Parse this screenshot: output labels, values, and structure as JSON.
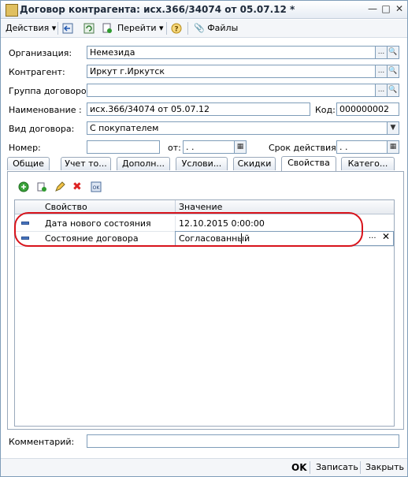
{
  "window": {
    "title": "Договор контрагента: исх.366/34074 от 05.07.12 *"
  },
  "toolbar": {
    "actions_label": "Действия",
    "goto_label": "Перейти",
    "files_label": "Файлы"
  },
  "form": {
    "organization_label": "Организация:",
    "organization_value": "Немезида",
    "contractor_label": "Контрагент:",
    "contractor_value": "Иркут г.Иркутск",
    "group_label": "Группа договоров:",
    "group_value": "",
    "name_label": "Наименование :",
    "name_value": "исх.366/34074 от 05.07.12",
    "code_label": "Код:",
    "code_value": "000000002",
    "type_label": "Вид договора:",
    "type_value": "С покупателем",
    "number_label": "Номер:",
    "number_value": "",
    "from_label": "от:",
    "from_value": " .  .",
    "term_label": "Срок действия:",
    "term_value": " .  ."
  },
  "tabs": [
    "Общие",
    "Учет то...",
    "Дополн...",
    "Услови...",
    "Скидки",
    "Свойства",
    "Катего..."
  ],
  "active_tab": "Свойства",
  "grid": {
    "columns": [
      "Свойство",
      "Значение"
    ],
    "rows": [
      {
        "property": "Дата нового состояния",
        "value": "12.10.2015 0:00:00"
      },
      {
        "property": "Состояние договора",
        "value": "Согласованный"
      }
    ]
  },
  "comment_label": "Комментарий:",
  "comment_value": "",
  "buttons": {
    "ok": "OK",
    "save": "Записать",
    "close": "Закрыть"
  },
  "colors": {
    "highlight": "#d8131b",
    "border": "#7f9db9"
  }
}
